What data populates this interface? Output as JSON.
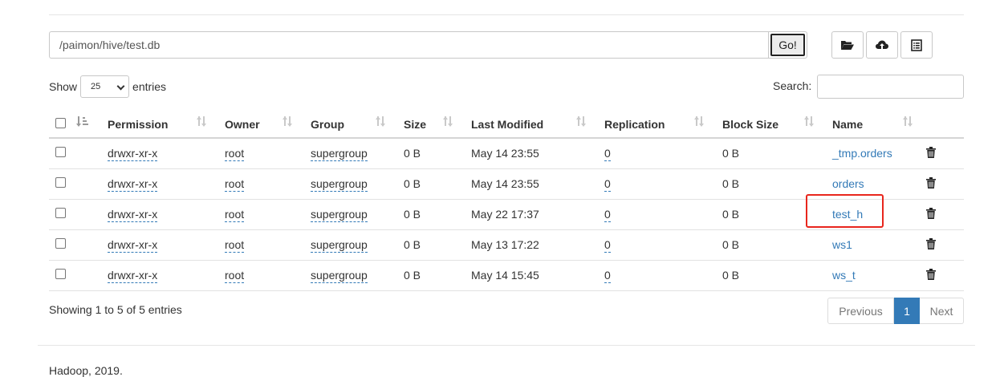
{
  "path_bar": {
    "value": "/paimon/hive/test.db",
    "go_label": "Go!"
  },
  "toolbar": {
    "icons": [
      "folder-open-icon",
      "cloud-upload-icon",
      "list-alt-icon"
    ]
  },
  "length": {
    "show": "Show",
    "value": "25",
    "entries": "entries"
  },
  "search": {
    "label": "Search:",
    "value": ""
  },
  "table": {
    "columns": [
      "Permission",
      "Owner",
      "Group",
      "Size",
      "Last Modified",
      "Replication",
      "Block Size",
      "Name"
    ],
    "rows": [
      {
        "permission": "drwxr-xr-x",
        "owner": "root",
        "group": "supergroup",
        "size": "0 B",
        "modified": "May 14 23:55",
        "replication": "0",
        "block_size": "0 B",
        "name": "_tmp.orders"
      },
      {
        "permission": "drwxr-xr-x",
        "owner": "root",
        "group": "supergroup",
        "size": "0 B",
        "modified": "May 14 23:55",
        "replication": "0",
        "block_size": "0 B",
        "name": "orders"
      },
      {
        "permission": "drwxr-xr-x",
        "owner": "root",
        "group": "supergroup",
        "size": "0 B",
        "modified": "May 22 17:37",
        "replication": "0",
        "block_size": "0 B",
        "name": "test_h"
      },
      {
        "permission": "drwxr-xr-x",
        "owner": "root",
        "group": "supergroup",
        "size": "0 B",
        "modified": "May 13 17:22",
        "replication": "0",
        "block_size": "0 B",
        "name": "ws1"
      },
      {
        "permission": "drwxr-xr-x",
        "owner": "root",
        "group": "supergroup",
        "size": "0 B",
        "modified": "May 14 15:45",
        "replication": "0",
        "block_size": "0 B",
        "name": "ws_t"
      }
    ]
  },
  "info": "Showing 1 to 5 of 5 entries",
  "pagination": {
    "previous": "Previous",
    "current": "1",
    "next": "Next"
  },
  "footer": "Hadoop, 2019.",
  "colors": {
    "link": "#337ab7",
    "highlight": "#e8261d",
    "active_page": "#337ab7"
  }
}
